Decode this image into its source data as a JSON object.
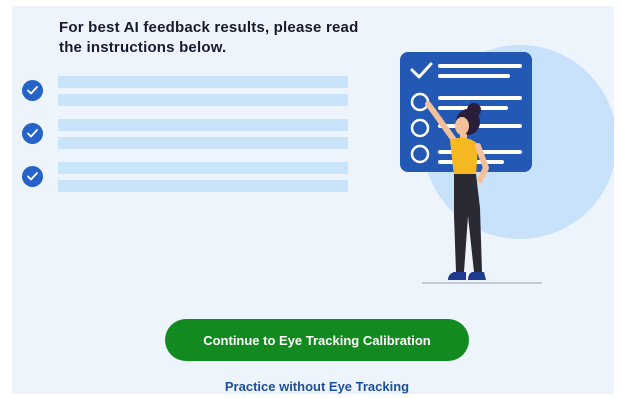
{
  "instructions": {
    "heading": "For best AI feedback results, please read the instructions below.",
    "item_count_visible": 3
  },
  "checklist": [
    {
      "state": "checked"
    },
    {
      "state": "checked"
    },
    {
      "state": "checked"
    }
  ],
  "actions": {
    "primary_label": "Continue to Eye Tracking Calibration",
    "secondary_label": "Practice without Eye Tracking"
  },
  "colors": {
    "panel_bg": "#eef4fb",
    "accent_blue": "#2563c9",
    "placeholder_bar": "#c9e3fb",
    "primary_button": "#138a1f",
    "link": "#1c4f9c"
  },
  "icons": [
    "checkmark-icon",
    "checklist-board-illustration",
    "person-illustration"
  ]
}
